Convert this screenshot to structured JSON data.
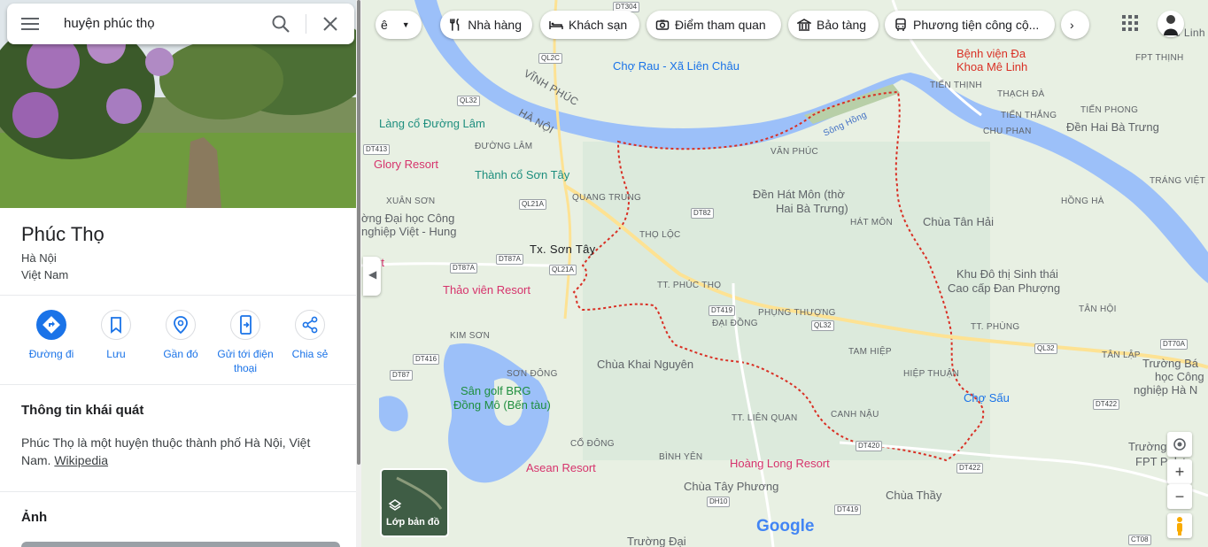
{
  "search": {
    "query": "huyện phúc thọ"
  },
  "place": {
    "name": "Phúc Thọ",
    "line1": "Hà Nội",
    "line2": "Việt Nam"
  },
  "actions": [
    {
      "label": "Đường đi"
    },
    {
      "label": "Lưu"
    },
    {
      "label": "Gần đó"
    },
    {
      "label": "Gửi tới điện thoại"
    },
    {
      "label": "Chia sẻ"
    }
  ],
  "overview": {
    "heading": "Thông tin khái quát",
    "text": "Phúc Thọ là một huyện thuộc thành phố Hà Nội, Việt Nam.",
    "link": "Wikipedia"
  },
  "photos": {
    "heading": "Ảnh"
  },
  "chips": [
    {
      "label": "Nhà hàng"
    },
    {
      "label": "Khách sạn"
    },
    {
      "label": "Điểm tham quan"
    },
    {
      "label": "Bảo tàng"
    },
    {
      "label": "Phương tiện công cộ..."
    }
  ],
  "map_labels": {
    "vinh_phuc": "VĨNH PHÚC",
    "ha_noi": "HÀ NỘI",
    "song_hong": "Sông Hồng",
    "son_tay": "Tx. Sơn Tây",
    "tt_phuc_tho": "TT. PHÚC THỌ",
    "phung_thuong": "PHỤNG THƯỢNG",
    "tt_phung": "TT. PHÙNG",
    "tho_loc": "THỌ LỘC",
    "van_phuc": "VĂN PHÚC",
    "hat_mon": "HÁT MÔN",
    "tam_hiep": "TAM HIỆP",
    "hiep_thuan": "HIỆP THUẬN",
    "dai_dong": "ĐẠI ĐỒNG",
    "lien_quan": "TT. LIÊN QUAN",
    "canh_nau": "CANH NẬU",
    "kim_son": "KIM SƠN",
    "son_dong": "SƠN ĐÔNG",
    "co_dong": "CỔ ĐÔNG",
    "binh_yen": "BÌNH YÊN",
    "xuan_son": "XUÂN SƠN",
    "duong_lam": "ĐƯỜNG LÂM",
    "quang_trung": "QUANG TRUNG",
    "tien_thinh": "TIẾN THỊNH",
    "thach_da": "THẠCH ĐÀ",
    "tien_phong": "TIẾN PHONG",
    "chu_phan": "CHU PHAN",
    "trang_viet": "TRÁNG VIỆT",
    "hong_ha": "HỒNG HÀ",
    "tan_hoi": "TÂN HỘI",
    "tan_lap": "TÂN LẬP",
    "tien_thang": "TIẾN THẮNG",
    "fpt_thinh": "FPT THỊNH",
    "me_linh": "Mê Linh"
  },
  "pois": {
    "cho_rau": "Chợ Rau - Xã Liên Châu",
    "benh_vien_1": "Bệnh viện Đa",
    "benh_vien_2": "Khoa Mê Linh",
    "lang_co": "Làng cổ Đường Lâm",
    "glory": "Glory Resort",
    "thanh_co": "Thành cổ Sơn Tây",
    "den_hat_mon_1": "Đền Hát Môn (thờ",
    "den_hat_mon_2": "Hai Bà Trưng)",
    "den_hai_ba": "Đền Hai Bà Trưng",
    "chua_tan_hai": "Chùa Tân Hải",
    "dai_hoc_1": "ờng Đại học Công",
    "dai_hoc_2": "nghiệp Việt - Hung",
    "thao_vien": "Thảo viên Resort",
    "khu_do_thi_1": "Khu Đô thị Sinh thái",
    "khu_do_thi_2": "Cao cấp Đan Phượng",
    "chua_khai_nguyen": "Chùa Khai Nguyên",
    "san_golf_1": "Sân golf BRG",
    "san_golf_2": "Đồng Mô (Bến tàu)",
    "cho_sau": "Chợ Sấu",
    "asean": "Asean Resort",
    "hoang_long": "Hoàng Long Resort",
    "chua_tay_phuong": "Chùa Tây Phương",
    "chua_thay": "Chùa Thầy",
    "truong_cao_1": "Trường Cao",
    "truong_cao_2": "FPT Polyte",
    "truong_bach_1": "Trường Bá",
    "truong_bach_2": "học Công",
    "truong_bach_3": "nghiệp Hà N",
    "truong_dai": "Trường Đại",
    "resort_left": "rt"
  },
  "roads": [
    "QL2C",
    "QL32",
    "DT413",
    "QL21A",
    "DT87A",
    "DT87A",
    "QL21A",
    "DT82",
    "DT419",
    "QL32",
    "QL32",
    "DT70A",
    "DT416",
    "DT87",
    "DT420",
    "DT422",
    "DT422",
    "DH10",
    "DT419",
    "DT304",
    "CT08"
  ],
  "layer_label": "Lớp bản đồ",
  "google": "Google",
  "colors": {
    "water": "#9cc0f9",
    "land": "#e8f0e3",
    "boundary": "#d93025",
    "road": "#fde293",
    "accent": "#1a73e8"
  }
}
